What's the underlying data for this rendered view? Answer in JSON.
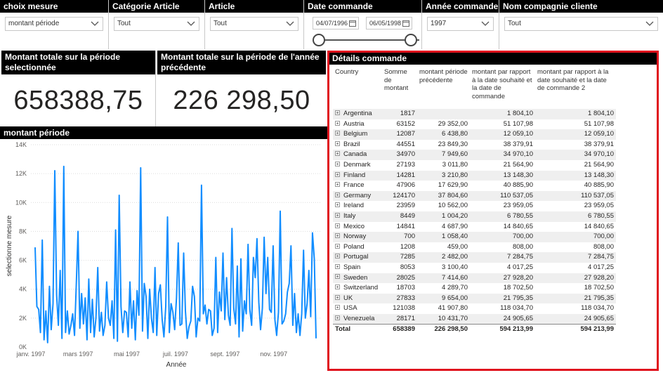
{
  "slicers": {
    "choix_mesure": {
      "title": "choix mesure",
      "value": "montant période"
    },
    "categorie": {
      "title": "Catégorie Article",
      "value": "Tout"
    },
    "article": {
      "title": "Article",
      "value": "Tout"
    },
    "date": {
      "title": "Date commande",
      "start": "04/07/1996",
      "end": "06/05/1998"
    },
    "annee": {
      "title": "Année commande",
      "value": "1997"
    },
    "compagnie": {
      "title": "Nom compagnie cliente",
      "value": "Tout"
    }
  },
  "cards": {
    "periode": {
      "title": "Montant totale sur la période selectionnée",
      "value": "658388,75"
    },
    "annee_prec": {
      "title": "Montant totale sur la période de l'année précédente",
      "value": "226 298,50"
    }
  },
  "chart": {
    "title": "montant période",
    "colors": {
      "line": "#118dff"
    }
  },
  "chart_data": {
    "type": "line",
    "title": "montant période",
    "xlabel": "Année",
    "ylabel": "selectionne mesure",
    "ylim": [
      0,
      14000
    ],
    "ytick_labels": [
      "0K",
      "2K",
      "4K",
      "6K",
      "8K",
      "10K",
      "12K",
      "14K"
    ],
    "x_range": [
      "1997-01-01",
      "1997-12-31"
    ],
    "x_ticks": [
      {
        "date": "1997-01-01",
        "label": "janv. 1997"
      },
      {
        "date": "1997-03-01",
        "label": "mars 1997"
      },
      {
        "date": "1997-05-01",
        "label": "mai 1997"
      },
      {
        "date": "1997-07-01",
        "label": "juil. 1997"
      },
      {
        "date": "1997-09-01",
        "label": "sept. 1997"
      },
      {
        "date": "1997-11-01",
        "label": "nov. 1997"
      }
    ],
    "grid": "horizontal-dotted",
    "series": [
      {
        "values": [
          6900,
          2800,
          2600,
          1000,
          7400,
          500,
          2500,
          300,
          4200,
          1200,
          3000,
          12200,
          3600,
          1500,
          5300,
          600,
          12500,
          1000,
          2500,
          900,
          1500,
          2300,
          800,
          4300,
          8000,
          1300,
          3700,
          1600,
          3400,
          500,
          4700,
          1000,
          3300,
          700,
          2000,
          5500,
          1100,
          2400,
          800,
          1500,
          4500,
          2000,
          1500,
          3200,
          600,
          8100,
          400,
          10500,
          2800,
          1000,
          2500,
          2400,
          700,
          4500,
          1300,
          3200,
          500,
          3900,
          2200,
          12400,
          1100,
          4400,
          3500,
          600,
          4000,
          2000,
          1000,
          5500,
          800,
          3700,
          4300,
          1900,
          700,
          2800,
          9000,
          1000,
          3000,
          2400,
          1200,
          3400,
          7200,
          1500,
          1600,
          6500,
          2500,
          600,
          1400,
          1800,
          4200,
          3500,
          700,
          2000,
          1800,
          11200,
          2300,
          2900,
          1600,
          2600,
          2500,
          800,
          1300,
          6200,
          1000,
          3800,
          2500,
          6500,
          1900,
          4800,
          2200,
          1500,
          8200,
          2700,
          1600,
          5600,
          700,
          6100,
          1100,
          3200,
          2300,
          7100,
          2600,
          1500,
          6200,
          4800,
          7500,
          3100,
          1200,
          2700,
          7600,
          3700,
          6200,
          2600,
          2400,
          7000,
          1900,
          800,
          2400,
          9400,
          1600,
          1800,
          2300,
          3800,
          4400,
          7000,
          1500,
          3700,
          1000,
          2300,
          800,
          2300,
          6700,
          2000,
          3000,
          5300,
          2100,
          7900,
          6100,
          600
        ]
      }
    ]
  },
  "details": {
    "title": "Détails commande",
    "headers": [
      "Country",
      "Somme de montant",
      "montant période précédente",
      "montant par rapport à la date souhaité et la date de commande",
      "montant par rapport à la date souhaité et la date de commande 2"
    ],
    "rows": [
      {
        "country": "Argentina",
        "somme": "1817",
        "prec": "",
        "souhaite": "1 804,10",
        "souhaite2": "1 804,10"
      },
      {
        "country": "Austria",
        "somme": "63152",
        "prec": "29 352,00",
        "souhaite": "51 107,98",
        "souhaite2": "51 107,98"
      },
      {
        "country": "Belgium",
        "somme": "12087",
        "prec": "6 438,80",
        "souhaite": "12 059,10",
        "souhaite2": "12 059,10"
      },
      {
        "country": "Brazil",
        "somme": "44551",
        "prec": "23 849,30",
        "souhaite": "38 379,91",
        "souhaite2": "38 379,91"
      },
      {
        "country": "Canada",
        "somme": "34970",
        "prec": "7 949,60",
        "souhaite": "34 970,10",
        "souhaite2": "34 970,10"
      },
      {
        "country": "Denmark",
        "somme": "27193",
        "prec": "3 011,80",
        "souhaite": "21 564,90",
        "souhaite2": "21 564,90"
      },
      {
        "country": "Finland",
        "somme": "14281",
        "prec": "3 210,80",
        "souhaite": "13 148,30",
        "souhaite2": "13 148,30"
      },
      {
        "country": "France",
        "somme": "47906",
        "prec": "17 629,90",
        "souhaite": "40 885,90",
        "souhaite2": "40 885,90"
      },
      {
        "country": "Germany",
        "somme": "124170",
        "prec": "37 804,60",
        "souhaite": "110 537,05",
        "souhaite2": "110 537,05"
      },
      {
        "country": "Ireland",
        "somme": "23959",
        "prec": "10 562,00",
        "souhaite": "23 959,05",
        "souhaite2": "23 959,05"
      },
      {
        "country": "Italy",
        "somme": "8449",
        "prec": "1 004,20",
        "souhaite": "6 780,55",
        "souhaite2": "6 780,55"
      },
      {
        "country": "Mexico",
        "somme": "14841",
        "prec": "4 687,90",
        "souhaite": "14 840,65",
        "souhaite2": "14 840,65"
      },
      {
        "country": "Norway",
        "somme": "700",
        "prec": "1 058,40",
        "souhaite": "700,00",
        "souhaite2": "700,00"
      },
      {
        "country": "Poland",
        "somme": "1208",
        "prec": "459,00",
        "souhaite": "808,00",
        "souhaite2": "808,00"
      },
      {
        "country": "Portugal",
        "somme": "7285",
        "prec": "2 482,00",
        "souhaite": "7 284,75",
        "souhaite2": "7 284,75"
      },
      {
        "country": "Spain",
        "somme": "8053",
        "prec": "3 100,40",
        "souhaite": "4 017,25",
        "souhaite2": "4 017,25"
      },
      {
        "country": "Sweden",
        "somme": "28025",
        "prec": "7 414,60",
        "souhaite": "27 928,20",
        "souhaite2": "27 928,20"
      },
      {
        "country": "Switzerland",
        "somme": "18703",
        "prec": "4 289,70",
        "souhaite": "18 702,50",
        "souhaite2": "18 702,50"
      },
      {
        "country": "UK",
        "somme": "27833",
        "prec": "9 654,00",
        "souhaite": "21 795,35",
        "souhaite2": "21 795,35"
      },
      {
        "country": "USA",
        "somme": "121038",
        "prec": "41 907,80",
        "souhaite": "118 034,70",
        "souhaite2": "118 034,70"
      },
      {
        "country": "Venezuela",
        "somme": "28171",
        "prec": "10 431,70",
        "souhaite": "24 905,65",
        "souhaite2": "24 905,65"
      }
    ],
    "total": {
      "label": "Total",
      "somme": "658389",
      "prec": "226 298,50",
      "souhaite": "594 213,99",
      "souhaite2": "594 213,99"
    }
  }
}
